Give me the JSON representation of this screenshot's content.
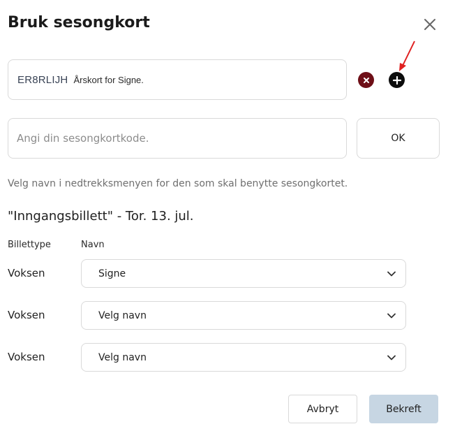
{
  "dialog": {
    "title": "Bruk sesongkort"
  },
  "season_card": {
    "code": "ER8RLIJH",
    "description": "Årskort for Signe."
  },
  "code_input": {
    "value": "",
    "placeholder": "Angi din sesongkortkode."
  },
  "ok_label": "OK",
  "hint": "Velg navn i nedtrekksmenyen for den som skal benytte sesongkortet.",
  "event_title": "\"Inngangsbillett\" - Tor. 13. jul.",
  "table": {
    "headers": {
      "type": "Billettype",
      "name": "Navn"
    },
    "rows": [
      {
        "type": "Voksen",
        "name": "Signe"
      },
      {
        "type": "Voksen",
        "name": "Velg navn"
      },
      {
        "type": "Voksen",
        "name": "Velg navn"
      }
    ]
  },
  "buttons": {
    "cancel": "Avbryt",
    "confirm": "Bekreft"
  },
  "icons": {
    "close": "close-icon",
    "remove": "remove-circle-icon",
    "add": "add-circle-icon",
    "dropdown": "chevron-down-icon"
  },
  "colors": {
    "remove": "#6e0f17",
    "add": "#0c0c0c",
    "confirm_bg": "#c7d6e3",
    "annotation_arrow": "#e02020"
  }
}
